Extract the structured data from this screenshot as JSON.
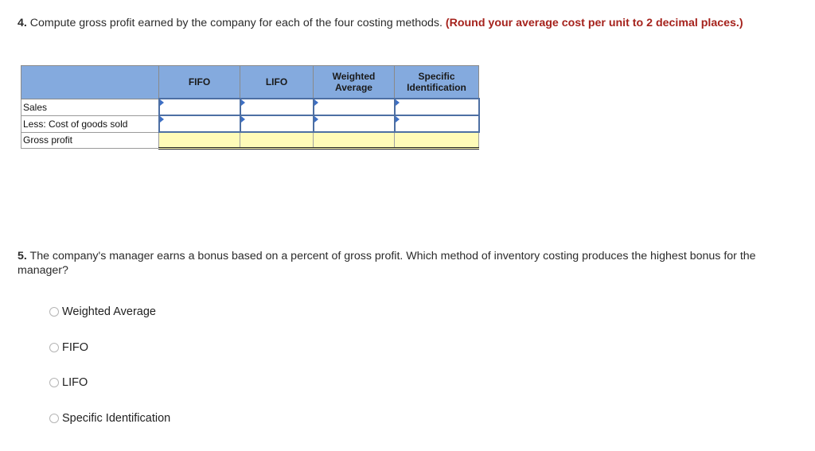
{
  "question4": {
    "number": "4.",
    "text": " Compute gross profit earned by the company for each of the four costing methods. ",
    "note": "(Round your average cost per unit to 2 decimal places.)"
  },
  "table": {
    "columns": [
      "",
      "FIFO",
      "LIFO",
      "Weighted Average",
      "Specific Identification"
    ],
    "column_lines": [
      [
        ""
      ],
      [
        "FIFO"
      ],
      [
        "LIFO"
      ],
      [
        "Weighted",
        "Average"
      ],
      [
        "Specific",
        "Identification"
      ]
    ],
    "rows": [
      {
        "label": "Sales",
        "values": [
          "",
          "",
          "",
          ""
        ],
        "type": "input"
      },
      {
        "label": "Less: Cost of goods sold",
        "values": [
          "",
          "",
          "",
          ""
        ],
        "type": "input"
      },
      {
        "label": "Gross profit",
        "values": [
          "",
          "",
          "",
          ""
        ],
        "type": "total"
      }
    ],
    "colors": {
      "header_bg": "#84aade",
      "total_bg": "#fffbb8",
      "input_border": "#4d6fa3"
    }
  },
  "question5": {
    "number": "5.",
    "text": " The company's manager earns a bonus based on a percent of gross profit. Which method of inventory costing produces the highest bonus for the manager?",
    "options": [
      "Weighted Average",
      "FIFO",
      "LIFO",
      "Specific Identification"
    ],
    "selected": null
  },
  "colors": {
    "note_red": "#a5221c",
    "text": "#2b2b2b"
  }
}
